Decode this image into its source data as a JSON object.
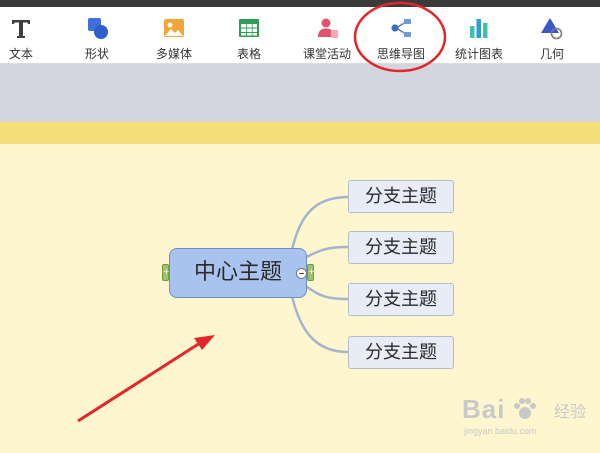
{
  "toolbar": {
    "items": [
      {
        "label": "文本",
        "icon": "text-icon"
      },
      {
        "label": "形状",
        "icon": "shape-icon"
      },
      {
        "label": "多媒体",
        "icon": "image-icon"
      },
      {
        "label": "表格",
        "icon": "table-icon"
      },
      {
        "label": "课堂活动",
        "icon": "classroom-activity-icon"
      },
      {
        "label": "思维导图",
        "icon": "mindmap-icon",
        "highlighted": true
      },
      {
        "label": "统计图表",
        "icon": "bar-chart-icon"
      },
      {
        "label": "几何",
        "icon": "geometry-icon"
      }
    ]
  },
  "mindmap": {
    "central_topic": "中心主题",
    "branches": [
      "分支主题",
      "分支主题",
      "分支主题",
      "分支主题"
    ]
  },
  "watermark": {
    "brand": "Bai",
    "brand_suffix": "经验",
    "site": "jingyan.baidu.com"
  },
  "colors": {
    "highlight_circle": "#e3262b",
    "arrow": "#e3262b",
    "canvas_bg": "#fdf6cf",
    "central_fill": "#a8c4ee",
    "branch_line": "#a4b4cc"
  }
}
